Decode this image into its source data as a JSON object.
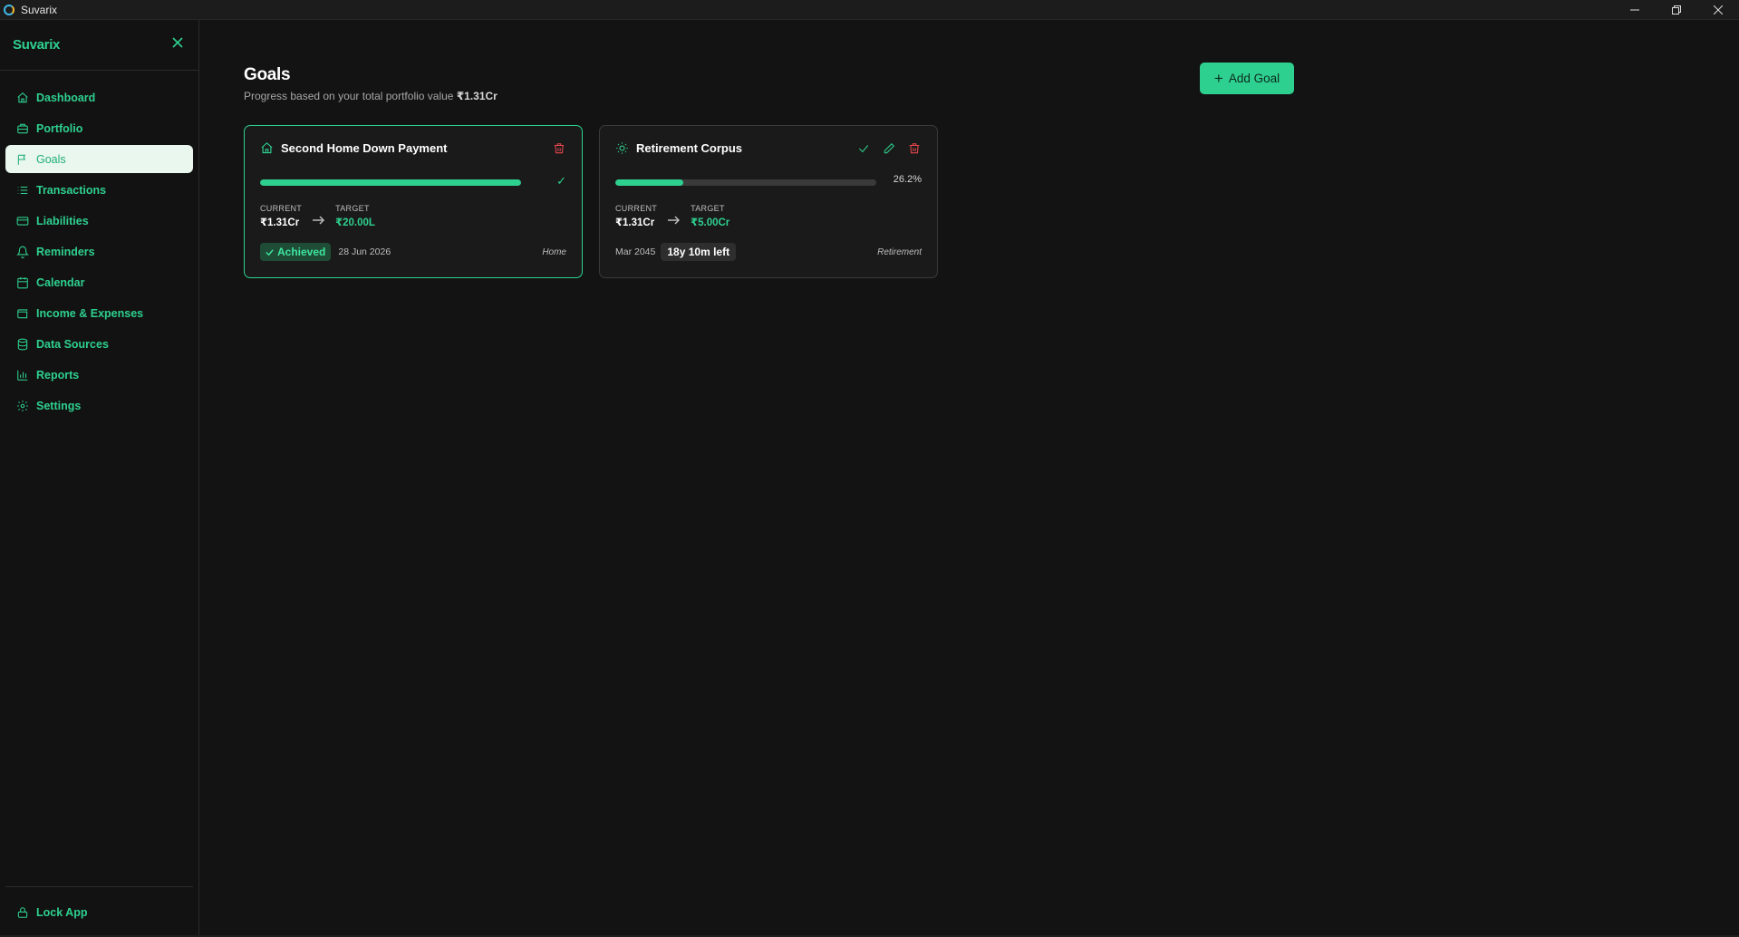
{
  "window": {
    "title": "Suvarix"
  },
  "sidebar": {
    "brand": "Suvarix",
    "items": [
      {
        "label": "Dashboard",
        "icon": "home-icon",
        "active": false
      },
      {
        "label": "Portfolio",
        "icon": "briefcase-icon",
        "active": false
      },
      {
        "label": "Goals",
        "icon": "flag-icon",
        "active": true
      },
      {
        "label": "Transactions",
        "icon": "list-icon",
        "active": false
      },
      {
        "label": "Liabilities",
        "icon": "credit-card-icon",
        "active": false
      },
      {
        "label": "Reminders",
        "icon": "bell-icon",
        "active": false
      },
      {
        "label": "Calendar",
        "icon": "calendar-icon",
        "active": false
      },
      {
        "label": "Income & Expenses",
        "icon": "wallet-icon",
        "active": false
      },
      {
        "label": "Data Sources",
        "icon": "database-icon",
        "active": false
      },
      {
        "label": "Reports",
        "icon": "bar-chart-icon",
        "active": false
      },
      {
        "label": "Settings",
        "icon": "gear-icon",
        "active": false
      }
    ],
    "lock_label": "Lock App"
  },
  "page": {
    "title": "Goals",
    "subtitle_prefix": "Progress based on your total portfolio value ",
    "subtitle_value": "₹1.31Cr",
    "add_goal_label": "Add Goal"
  },
  "goals": [
    {
      "title": "Second Home Down Payment",
      "icon": "home-icon",
      "progress_percent": 100,
      "progress_end": "✓",
      "current_label": "CURRENT",
      "current_value": "₹1.31Cr",
      "target_label": "TARGET",
      "target_value": "₹20.00L",
      "status": "Achieved",
      "date": "28 Jun 2026",
      "category": "Home"
    },
    {
      "title": "Retirement Corpus",
      "icon": "sun-icon",
      "progress_percent": 26.2,
      "progress_end": "26.2%",
      "current_label": "CURRENT",
      "current_value": "₹1.31Cr",
      "target_label": "TARGET",
      "target_value": "₹5.00Cr",
      "date": "Mar 2045",
      "time_left": "18y 10m left",
      "category": "Retirement"
    }
  ],
  "colors": {
    "accent": "#2ed08f",
    "danger": "#e5484d",
    "background": "#131313",
    "card": "#1a1a1a"
  }
}
